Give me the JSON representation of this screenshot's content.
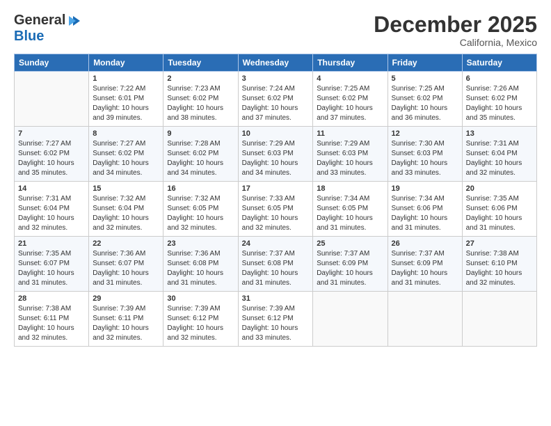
{
  "header": {
    "logo_general": "General",
    "logo_blue": "Blue",
    "month_title": "December 2025",
    "location": "California, Mexico"
  },
  "calendar": {
    "days_of_week": [
      "Sunday",
      "Monday",
      "Tuesday",
      "Wednesday",
      "Thursday",
      "Friday",
      "Saturday"
    ],
    "weeks": [
      [
        {
          "day": "",
          "info": ""
        },
        {
          "day": "1",
          "info": "Sunrise: 7:22 AM\nSunset: 6:01 PM\nDaylight: 10 hours\nand 39 minutes."
        },
        {
          "day": "2",
          "info": "Sunrise: 7:23 AM\nSunset: 6:02 PM\nDaylight: 10 hours\nand 38 minutes."
        },
        {
          "day": "3",
          "info": "Sunrise: 7:24 AM\nSunset: 6:02 PM\nDaylight: 10 hours\nand 37 minutes."
        },
        {
          "day": "4",
          "info": "Sunrise: 7:25 AM\nSunset: 6:02 PM\nDaylight: 10 hours\nand 37 minutes."
        },
        {
          "day": "5",
          "info": "Sunrise: 7:25 AM\nSunset: 6:02 PM\nDaylight: 10 hours\nand 36 minutes."
        },
        {
          "day": "6",
          "info": "Sunrise: 7:26 AM\nSunset: 6:02 PM\nDaylight: 10 hours\nand 35 minutes."
        }
      ],
      [
        {
          "day": "7",
          "info": "Sunrise: 7:27 AM\nSunset: 6:02 PM\nDaylight: 10 hours\nand 35 minutes."
        },
        {
          "day": "8",
          "info": "Sunrise: 7:27 AM\nSunset: 6:02 PM\nDaylight: 10 hours\nand 34 minutes."
        },
        {
          "day": "9",
          "info": "Sunrise: 7:28 AM\nSunset: 6:02 PM\nDaylight: 10 hours\nand 34 minutes."
        },
        {
          "day": "10",
          "info": "Sunrise: 7:29 AM\nSunset: 6:03 PM\nDaylight: 10 hours\nand 34 minutes."
        },
        {
          "day": "11",
          "info": "Sunrise: 7:29 AM\nSunset: 6:03 PM\nDaylight: 10 hours\nand 33 minutes."
        },
        {
          "day": "12",
          "info": "Sunrise: 7:30 AM\nSunset: 6:03 PM\nDaylight: 10 hours\nand 33 minutes."
        },
        {
          "day": "13",
          "info": "Sunrise: 7:31 AM\nSunset: 6:04 PM\nDaylight: 10 hours\nand 32 minutes."
        }
      ],
      [
        {
          "day": "14",
          "info": "Sunrise: 7:31 AM\nSunset: 6:04 PM\nDaylight: 10 hours\nand 32 minutes."
        },
        {
          "day": "15",
          "info": "Sunrise: 7:32 AM\nSunset: 6:04 PM\nDaylight: 10 hours\nand 32 minutes."
        },
        {
          "day": "16",
          "info": "Sunrise: 7:32 AM\nSunset: 6:05 PM\nDaylight: 10 hours\nand 32 minutes."
        },
        {
          "day": "17",
          "info": "Sunrise: 7:33 AM\nSunset: 6:05 PM\nDaylight: 10 hours\nand 32 minutes."
        },
        {
          "day": "18",
          "info": "Sunrise: 7:34 AM\nSunset: 6:05 PM\nDaylight: 10 hours\nand 31 minutes."
        },
        {
          "day": "19",
          "info": "Sunrise: 7:34 AM\nSunset: 6:06 PM\nDaylight: 10 hours\nand 31 minutes."
        },
        {
          "day": "20",
          "info": "Sunrise: 7:35 AM\nSunset: 6:06 PM\nDaylight: 10 hours\nand 31 minutes."
        }
      ],
      [
        {
          "day": "21",
          "info": "Sunrise: 7:35 AM\nSunset: 6:07 PM\nDaylight: 10 hours\nand 31 minutes."
        },
        {
          "day": "22",
          "info": "Sunrise: 7:36 AM\nSunset: 6:07 PM\nDaylight: 10 hours\nand 31 minutes."
        },
        {
          "day": "23",
          "info": "Sunrise: 7:36 AM\nSunset: 6:08 PM\nDaylight: 10 hours\nand 31 minutes."
        },
        {
          "day": "24",
          "info": "Sunrise: 7:37 AM\nSunset: 6:08 PM\nDaylight: 10 hours\nand 31 minutes."
        },
        {
          "day": "25",
          "info": "Sunrise: 7:37 AM\nSunset: 6:09 PM\nDaylight: 10 hours\nand 31 minutes."
        },
        {
          "day": "26",
          "info": "Sunrise: 7:37 AM\nSunset: 6:09 PM\nDaylight: 10 hours\nand 31 minutes."
        },
        {
          "day": "27",
          "info": "Sunrise: 7:38 AM\nSunset: 6:10 PM\nDaylight: 10 hours\nand 32 minutes."
        }
      ],
      [
        {
          "day": "28",
          "info": "Sunrise: 7:38 AM\nSunset: 6:11 PM\nDaylight: 10 hours\nand 32 minutes."
        },
        {
          "day": "29",
          "info": "Sunrise: 7:39 AM\nSunset: 6:11 PM\nDaylight: 10 hours\nand 32 minutes."
        },
        {
          "day": "30",
          "info": "Sunrise: 7:39 AM\nSunset: 6:12 PM\nDaylight: 10 hours\nand 32 minutes."
        },
        {
          "day": "31",
          "info": "Sunrise: 7:39 AM\nSunset: 6:12 PM\nDaylight: 10 hours\nand 33 minutes."
        },
        {
          "day": "",
          "info": ""
        },
        {
          "day": "",
          "info": ""
        },
        {
          "day": "",
          "info": ""
        }
      ]
    ]
  }
}
